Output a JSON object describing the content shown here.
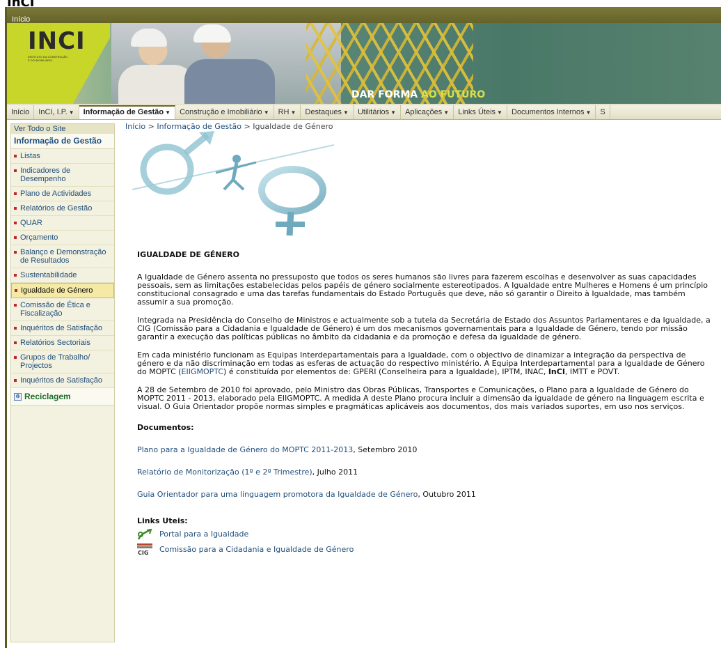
{
  "page": {
    "top_title": "InCI"
  },
  "topbar": {
    "label": "Início"
  },
  "banner": {
    "logo_text": "INCI",
    "logo_sub": "INSTITUTO DA CONSTRUÇÃO E DO IMOBILIÁRIO",
    "slogan_part1": "DAR FORMA ",
    "slogan_part2": "AO FUTURO"
  },
  "nav": {
    "items": [
      {
        "label": "Início",
        "dropdown": false
      },
      {
        "label": "InCI, I.P.",
        "dropdown": true
      },
      {
        "label": "Informação de Gestão",
        "dropdown": true,
        "active": true
      },
      {
        "label": "Construção e Imobiliário",
        "dropdown": true
      },
      {
        "label": "RH",
        "dropdown": true
      },
      {
        "label": "Destaques",
        "dropdown": true
      },
      {
        "label": "Utilitários",
        "dropdown": true
      },
      {
        "label": "Aplicações",
        "dropdown": true
      },
      {
        "label": "Links Úteis",
        "dropdown": true
      },
      {
        "label": "Documentos Internos",
        "dropdown": true
      },
      {
        "label": "S",
        "dropdown": false
      }
    ],
    "caret": "▼"
  },
  "sidebar": {
    "view_all": "Ver Todo o Site",
    "heading": "Informação de Gestão",
    "items": [
      {
        "label": "Listas"
      },
      {
        "label": "Indicadores de Desempenho"
      },
      {
        "label": "Plano de Actividades"
      },
      {
        "label": "Relatórios de Gestão"
      },
      {
        "label": "QUAR"
      },
      {
        "label": "Orçamento"
      },
      {
        "label": "Balanço e Demonstração de Resultados"
      },
      {
        "label": "Sustentabilidade"
      },
      {
        "label": "Igualdade de Género",
        "active": true
      },
      {
        "label": "Comissão de Ética e Fiscalização"
      },
      {
        "label": "Inquéritos de Satisfação"
      },
      {
        "label": "Relatórios Sectoriais"
      },
      {
        "label": "Grupos de Trabalho/ Projectos"
      },
      {
        "label": "Inquéritos de Satisfação"
      }
    ],
    "recycle": "Reciclagem"
  },
  "breadcrumb": {
    "home": "Início",
    "sep": ">",
    "section": "Informação de Gestão",
    "current": "Igualdade de Género"
  },
  "content": {
    "title": "IGUALDADE DE GÉNERO",
    "p1": "A Igualdade de Género assenta no pressuposto que todos os seres humanos são livres para fazerem escolhas e desenvolver as suas capacidades pessoais, sem as limitações estabelecidas pelos papéis de género socialmente estereotipados. A Igualdade entre Mulheres e Homens é um princípio constitucional consagrado e uma das tarefas fundamentais do Estado Português que deve, não só garantir o Direito à Igualdade, mas também assumir a sua promoção.",
    "p2": "Integrada na Presidência do Conselho de Ministros e actualmente sob a tutela da Secretária de Estado dos Assuntos Parlamentares e da Igualdade, a CIG (Comissão para a Cidadania e Igualdade de Género) é um dos mecanismos governamentais para a Igualdade de Género, tendo por missão garantir a execução das políticas públicas no âmbito da cidadania e da promoção e defesa da igualdade de género.",
    "p3_a": "Em cada ministério funcionam as Equipas Interdepartamentais para a Igualdade, com o objectivo de dinamizar a integração da perspectiva de género e da não discriminação em todas as esferas de actuação do respectivo ministério. A Equipa Interdepartamental para a Igualdade de Género do MOPTC (",
    "p3_link": "EIIGMOPTC",
    "p3_b": ") é constituída por elementos de: GPERI (Conselheira para a Igualdade), IPTM, INAC, ",
    "p3_bold": "InCI",
    "p3_c": ", IMTT e POVT.",
    "p4": "A 28 de Setembro de 2010 foi aprovado, pelo Ministro das Obras Públicas, Transportes e Comunicações, o Plano para a Igualdade de Género do MOPTC 2011 - 2013, elaborado pela EIIGMOPTC. A medida A deste Plano procura incluir a dimensão da igualdade de género na linguagem escrita e visual. O Guia Orientador propõe normas simples e pragmáticas aplicáveis aos documentos, dos mais variados suportes, em uso nos serviços.",
    "docs_heading": "Documentos:",
    "docs": [
      {
        "link": "Plano para a Igualdade de Género do MOPTC 2011-2013",
        "suffix": ", Setembro 2010"
      },
      {
        "link": "Relatório de Monitorização (1º e 2º Trimestre)",
        "suffix": ", Julho 2011"
      },
      {
        "link": "Guia Orientador para uma linguagem promotora da Igualdade de Género",
        "suffix": ", Outubro 2011"
      }
    ],
    "links_heading": "Links Uteis:",
    "links": [
      {
        "label": "Portal para a Igualdade"
      },
      {
        "label": "Comissão para a Cidadania e Igualdade de Género",
        "icon_text": "CIG"
      }
    ]
  },
  "colors": {
    "olive": "#6d6a2e",
    "link": "#1f4d7a",
    "lime": "#c8d62a"
  }
}
